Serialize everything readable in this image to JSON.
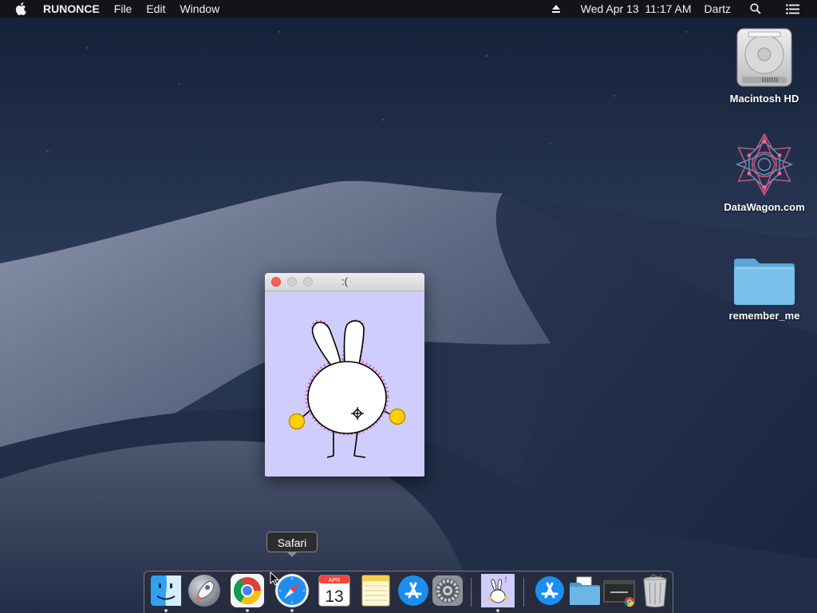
{
  "menubar": {
    "apple_icon": "apple-logo-icon",
    "app_name": "RUNONCE",
    "menus": [
      "File",
      "Edit",
      "Window"
    ],
    "date_time": "Wed Apr 13  11:17 AM",
    "user": "Dartz",
    "status_icons": [
      "eject-icon",
      "spotlight-search-icon",
      "notification-center-icon"
    ]
  },
  "desktop": {
    "icons": [
      {
        "label": "Macintosh HD",
        "icon": "hard-drive-icon"
      },
      {
        "label": "DataWagon.com",
        "icon": "geometric-star-icon"
      },
      {
        "label": "remember_me",
        "icon": "folder-icon"
      }
    ]
  },
  "window": {
    "title": ":(",
    "background": "#cfcdfb",
    "content": "bunny-drawing"
  },
  "tooltip": {
    "label": "Safari"
  },
  "dock": {
    "items": [
      {
        "name": "Finder",
        "icon": "finder-icon",
        "running": true
      },
      {
        "name": "Launchpad",
        "icon": "launchpad-rocket-icon",
        "running": false
      },
      {
        "name": "Google Chrome",
        "icon": "chrome-icon",
        "running": true
      },
      {
        "name": "Safari",
        "icon": "safari-compass-icon",
        "running": true
      },
      {
        "name": "Calendar",
        "icon": "calendar-icon",
        "month": "APR",
        "day": "13",
        "running": false
      },
      {
        "name": "Notes",
        "icon": "notes-icon",
        "running": false
      },
      {
        "name": "App Store",
        "icon": "app-store-icon",
        "running": false
      },
      {
        "name": "System Preferences",
        "icon": "gear-icon",
        "running": false
      },
      {
        "name": "RUNONCE",
        "icon": "bunny-app-icon",
        "running": true
      },
      {
        "name": "Applications",
        "icon": "applications-stack-icon",
        "running": false
      },
      {
        "name": "Documents",
        "icon": "documents-folder-icon",
        "running": false
      },
      {
        "name": "Chrome Tab",
        "icon": "minimized-window-icon",
        "running": false
      },
      {
        "name": "Trash",
        "icon": "trash-icon",
        "running": false
      }
    ]
  },
  "colors": {
    "accent_close": "#fc5f57",
    "menubar": "#141416"
  }
}
